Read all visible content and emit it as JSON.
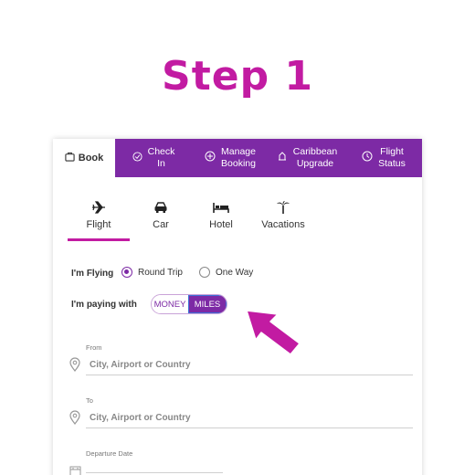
{
  "heading": "Step 1",
  "tabs": {
    "book": "Book",
    "check_in": "Check\nIn",
    "manage_booking": "Manage\nBooking",
    "caribbean_upgrade": "Caribbean\nUpgrade",
    "flight_status": "Flight\nStatus"
  },
  "subtabs": {
    "flight": "Flight",
    "car": "Car",
    "hotel": "Hotel",
    "vacations": "Vacations",
    "active": "Flight"
  },
  "flying": {
    "label": "I'm Flying",
    "options": [
      "Round Trip",
      "One Way"
    ],
    "selected": "Round Trip"
  },
  "paying": {
    "label": "I'm paying with",
    "options": [
      "MONEY",
      "MILES"
    ],
    "selected": "MILES"
  },
  "from": {
    "label": "From",
    "placeholder": "City, Airport or Country"
  },
  "to": {
    "label": "To",
    "placeholder": "City, Airport or Country"
  },
  "departure": {
    "label": "Departure Date"
  },
  "colors": {
    "brand_purple": "#7d2aa5",
    "accent_magenta": "#c21ba2"
  },
  "icons": [
    "briefcase-icon",
    "check-icon",
    "booking-icon",
    "upgrade-icon",
    "clock-icon",
    "plane-icon",
    "car-icon",
    "bed-icon",
    "palm-tree-icon",
    "location-pin-icon",
    "calendar-icon",
    "pointer-arrow-icon"
  ]
}
